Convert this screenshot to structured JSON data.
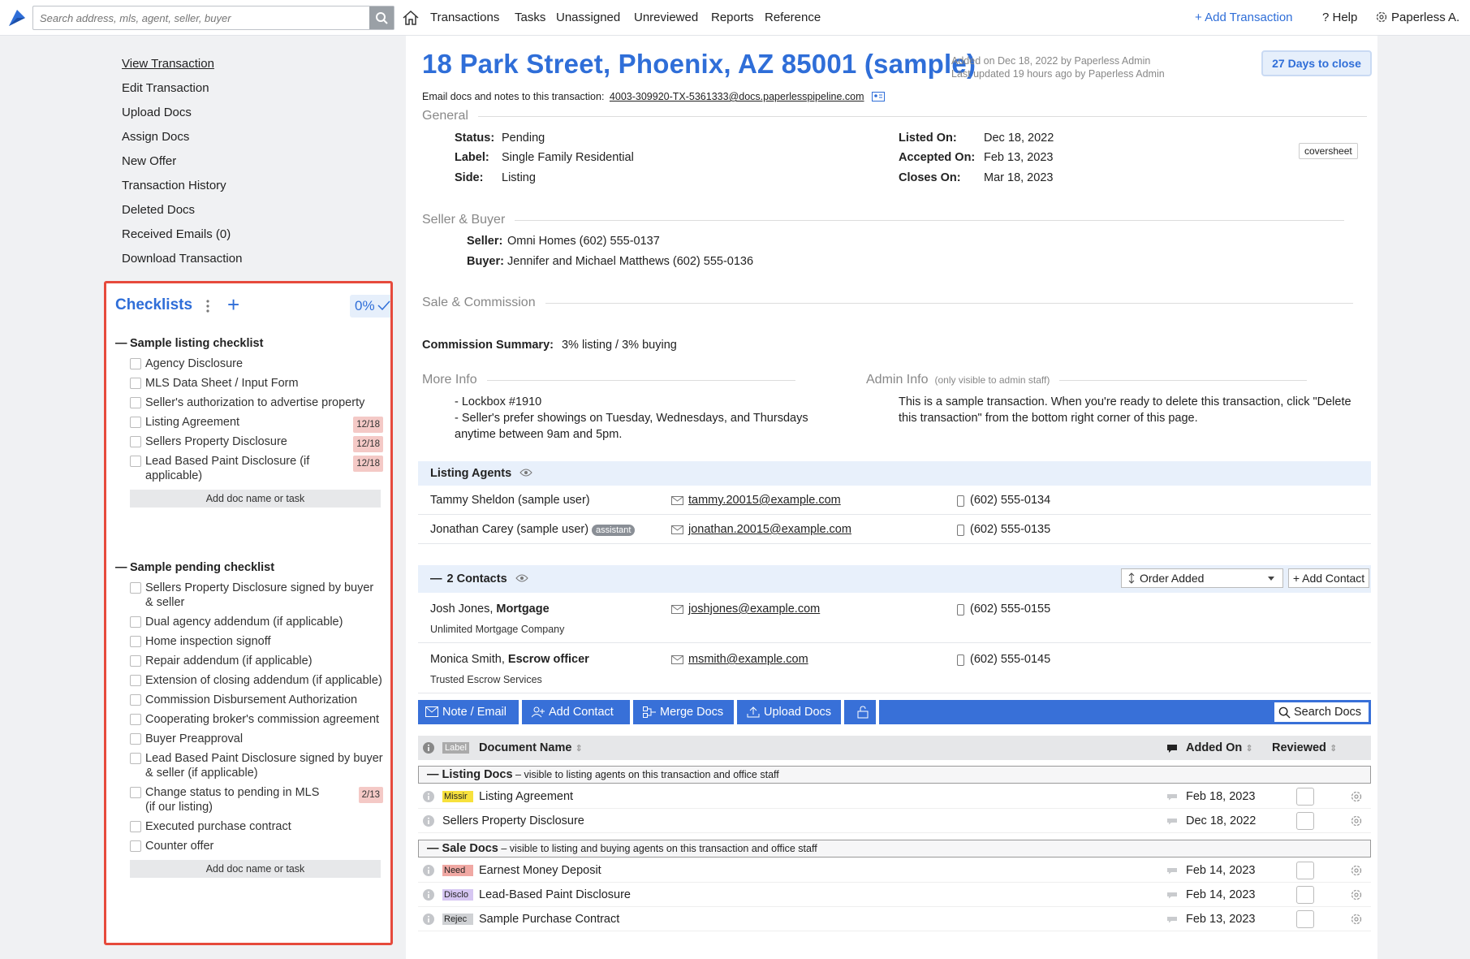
{
  "nav": {
    "search_placeholder": "Search address, mls, agent, seller, buyer",
    "links": [
      "Transactions",
      "Tasks",
      "Unassigned",
      "Unreviewed",
      "Reports",
      "Reference"
    ],
    "add_transaction": "+ Add Transaction",
    "help": "? Help",
    "user": "Paperless A."
  },
  "sidebar": {
    "links": [
      "View Transaction",
      "Edit Transaction",
      "Upload Docs",
      "Assign Docs",
      "New Offer",
      "Transaction History",
      "Deleted Docs",
      "Received Emails (0)",
      "Download Transaction"
    ]
  },
  "checklists": {
    "title": "Checklists",
    "percent": "0%",
    "add_label": "Add doc name or task",
    "groups": [
      {
        "title": "Sample listing checklist",
        "items": [
          {
            "text": "Agency Disclosure",
            "due": ""
          },
          {
            "text": "MLS Data Sheet / Input Form",
            "due": ""
          },
          {
            "text": "Seller's authorization to advertise property",
            "due": ""
          },
          {
            "text": "Listing Agreement",
            "due": "12/18"
          },
          {
            "text": "Sellers Property Disclosure",
            "due": "12/18"
          },
          {
            "text": "Lead Based Paint Disclosure (if applicable)",
            "due": "12/18"
          }
        ]
      },
      {
        "title": "Sample pending checklist",
        "items": [
          {
            "text": "Sellers Property Disclosure signed by buyer & seller",
            "due": ""
          },
          {
            "text": "Dual agency addendum (if applicable)",
            "due": ""
          },
          {
            "text": "Home inspection signoff",
            "due": ""
          },
          {
            "text": "Repair addendum (if applicable)",
            "due": ""
          },
          {
            "text": "Extension of closing addendum (if applicable)",
            "due": ""
          },
          {
            "text": "Commission Disbursement Authorization",
            "due": ""
          },
          {
            "text": "Cooperating broker's commission agreement",
            "due": ""
          },
          {
            "text": "Buyer Preapproval",
            "due": ""
          },
          {
            "text": "Lead Based Paint Disclosure signed by buyer & seller (if applicable)",
            "due": ""
          },
          {
            "text": "Change status to pending in MLS (if our listing)",
            "due": "2/13"
          },
          {
            "text": "Executed purchase contract",
            "due": ""
          },
          {
            "text": "Counter offer",
            "due": ""
          }
        ]
      }
    ]
  },
  "transaction": {
    "title": "18 Park Street, Phoenix, AZ 85001 (sample)",
    "added": "Added on Dec 18, 2022 by Paperless Admin",
    "updated": "Last updated 19 hours ago by Paperless Admin",
    "days_to_close": "27 Days to close",
    "email_label": "Email docs and notes to this transaction:",
    "email_address": "4003-309920-TX-5361333@docs.paperlesspipeline.com",
    "coversheet": "coversheet"
  },
  "general": {
    "heading": "General",
    "status_k": "Status:",
    "status_v": "Pending",
    "label_k": "Label:",
    "label_v": "Single Family Residential",
    "side_k": "Side:",
    "side_v": "Listing",
    "listed_k": "Listed On:",
    "listed_v": "Dec 18, 2022",
    "accepted_k": "Accepted On:",
    "accepted_v": "Feb 13, 2023",
    "closes_k": "Closes On:",
    "closes_v": "Mar 18, 2023"
  },
  "seller_buyer": {
    "heading": "Seller & Buyer",
    "seller_k": "Seller:",
    "seller_v": "Omni Homes (602) 555-0137",
    "buyer_k": "Buyer:",
    "buyer_v": "Jennifer and Michael Matthews (602) 555-0136"
  },
  "sale": {
    "heading": "Sale & Commission",
    "summary_k": "Commission Summary:",
    "summary_v": "3% listing / 3% buying"
  },
  "more_info": {
    "heading": "More Info",
    "line1": "- Lockbox #1910",
    "line2": "- Seller's prefer showings on Tuesday, Wednesdays, and Thursdays anytime between 9am and 5pm."
  },
  "admin_info": {
    "heading": "Admin Info",
    "note": "(only visible to admin staff)",
    "text": "This is a sample transaction. When you're ready to delete this transaction, click \"Delete this transaction\" from the bottom right corner of this page."
  },
  "listing_agents": {
    "heading": "Listing Agents",
    "rows": [
      {
        "name": "Tammy Sheldon (sample user)",
        "email": "tammy.20015@example.com",
        "phone": "(602) 555-0134",
        "tag": ""
      },
      {
        "name": "Jonathan Carey (sample user)",
        "email": "jonathan.20015@example.com",
        "phone": "(602) 555-0135",
        "tag": "assistant"
      }
    ]
  },
  "contacts": {
    "heading": "2 Contacts",
    "order": "Order Added",
    "add": "+ Add Contact",
    "rows": [
      {
        "name": "Josh Jones,",
        "role": "Mortgage",
        "company": "Unlimited Mortgage Company",
        "email": "joshjones@example.com",
        "phone": "(602) 555-0155"
      },
      {
        "name": "Monica Smith,",
        "role": "Escrow officer",
        "company": "Trusted Escrow Services",
        "email": "msmith@example.com",
        "phone": "(602) 555-0145"
      }
    ]
  },
  "toolbar": {
    "note_email": "Note / Email",
    "add_contact": "Add Contact",
    "merge_docs": "Merge Docs",
    "upload_docs": "Upload Docs",
    "search_docs": "Search Docs"
  },
  "docs": {
    "col_label": "Label",
    "col_name": "Document Name",
    "col_added": "Added On",
    "col_reviewed": "Reviewed",
    "listing_section": "Listing Docs",
    "listing_desc": " – visible to listing agents on this transaction and office staff",
    "sale_section": "Sale Docs",
    "sale_desc": " – visible to listing and buying agents on this transaction and office staff",
    "listing_rows": [
      {
        "label": "Missir",
        "label_color": "#f7e13c",
        "name": "Listing Agreement",
        "date": "Feb 18, 2023"
      },
      {
        "label": "",
        "label_color": "",
        "name": "Sellers Property Disclosure",
        "date": "Dec 18, 2022"
      }
    ],
    "sale_rows": [
      {
        "label": "Need",
        "label_color": "#f0a8a3",
        "name": "Earnest Money Deposit",
        "date": "Feb 14, 2023"
      },
      {
        "label": "Disclo",
        "label_color": "#d6c6f2",
        "name": "Lead-Based Paint Disclosure",
        "date": "Feb 14, 2023"
      },
      {
        "label": "Rejec",
        "label_color": "#cfd1d4",
        "name": "Sample Purchase Contract",
        "date": "Feb 13, 2023"
      }
    ]
  },
  "colors": {
    "accent": "#2f6ed8",
    "toolbar": "#3870d8",
    "highlight_border": "#e64a3c"
  }
}
